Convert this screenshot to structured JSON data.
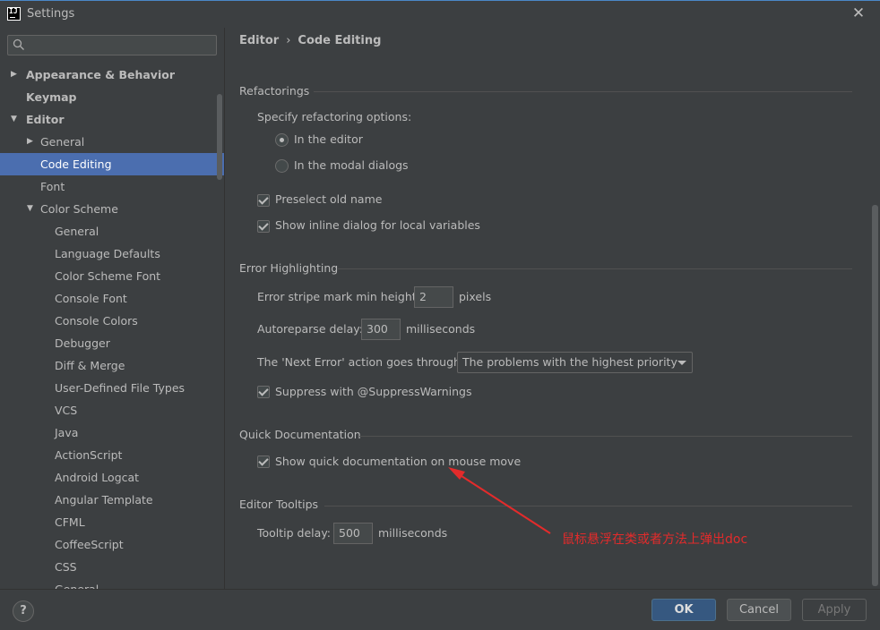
{
  "window": {
    "title": "Settings",
    "app_icon_text": "IJ"
  },
  "search": {
    "placeholder": ""
  },
  "tree": [
    {
      "label": "Appearance & Behavior",
      "level": 0,
      "arrow": "right",
      "bold": true,
      "selected": false
    },
    {
      "label": "Keymap",
      "level": 0,
      "arrow": "",
      "bold": true,
      "selected": false
    },
    {
      "label": "Editor",
      "level": 0,
      "arrow": "down",
      "bold": true,
      "selected": false
    },
    {
      "label": "General",
      "level": 1,
      "arrow": "right",
      "bold": false,
      "selected": false
    },
    {
      "label": "Code Editing",
      "level": 1,
      "arrow": "",
      "bold": false,
      "selected": true
    },
    {
      "label": "Font",
      "level": 1,
      "arrow": "",
      "bold": false,
      "selected": false
    },
    {
      "label": "Color Scheme",
      "level": 1,
      "arrow": "down",
      "bold": false,
      "selected": false
    },
    {
      "label": "General",
      "level": 2,
      "arrow": "",
      "bold": false,
      "selected": false
    },
    {
      "label": "Language Defaults",
      "level": 2,
      "arrow": "",
      "bold": false,
      "selected": false
    },
    {
      "label": "Color Scheme Font",
      "level": 2,
      "arrow": "",
      "bold": false,
      "selected": false
    },
    {
      "label": "Console Font",
      "level": 2,
      "arrow": "",
      "bold": false,
      "selected": false
    },
    {
      "label": "Console Colors",
      "level": 2,
      "arrow": "",
      "bold": false,
      "selected": false
    },
    {
      "label": "Debugger",
      "level": 2,
      "arrow": "",
      "bold": false,
      "selected": false
    },
    {
      "label": "Diff & Merge",
      "level": 2,
      "arrow": "",
      "bold": false,
      "selected": false
    },
    {
      "label": "User-Defined File Types",
      "level": 2,
      "arrow": "",
      "bold": false,
      "selected": false
    },
    {
      "label": "VCS",
      "level": 2,
      "arrow": "",
      "bold": false,
      "selected": false
    },
    {
      "label": "Java",
      "level": 2,
      "arrow": "",
      "bold": false,
      "selected": false
    },
    {
      "label": "ActionScript",
      "level": 2,
      "arrow": "",
      "bold": false,
      "selected": false
    },
    {
      "label": "Android Logcat",
      "level": 2,
      "arrow": "",
      "bold": false,
      "selected": false
    },
    {
      "label": "Angular Template",
      "level": 2,
      "arrow": "",
      "bold": false,
      "selected": false
    },
    {
      "label": "CFML",
      "level": 2,
      "arrow": "",
      "bold": false,
      "selected": false
    },
    {
      "label": "CoffeeScript",
      "level": 2,
      "arrow": "",
      "bold": false,
      "selected": false
    },
    {
      "label": "CSS",
      "level": 2,
      "arrow": "",
      "bold": false,
      "selected": false
    },
    {
      "label": "General",
      "level": 2,
      "arrow": "",
      "bold": false,
      "selected": false
    }
  ],
  "breadcrumb": {
    "part1": "Editor",
    "separator": "›",
    "part2": "Code Editing"
  },
  "refactorings": {
    "title": "Refactorings",
    "specify_label": "Specify refactoring options:",
    "radio_editor": "In the editor",
    "radio_editor_selected": true,
    "radio_modal": "In the modal dialogs",
    "radio_modal_selected": false,
    "preselect_label": "Preselect old name",
    "preselect_checked": true,
    "inline_dialog_label": "Show inline dialog for local variables",
    "inline_dialog_checked": true
  },
  "error_highlighting": {
    "title": "Error Highlighting",
    "stripe_label": "Error stripe mark min height:",
    "stripe_value": "2",
    "stripe_unit": "pixels",
    "autoreparse_label": "Autoreparse delay:",
    "autoreparse_value": "300",
    "autoreparse_unit": "milliseconds",
    "next_error_label": "The 'Next Error' action goes through:",
    "next_error_value": "The problems with the highest priority",
    "suppress_label": "Suppress with @SuppressWarnings",
    "suppress_checked": true
  },
  "quick_documentation": {
    "title": "Quick Documentation",
    "show_doc_label": "Show quick documentation on mouse move",
    "show_doc_checked": true
  },
  "editor_tooltips": {
    "title": "Editor Tooltips",
    "delay_label": "Tooltip delay:",
    "delay_value": "500",
    "delay_unit": "milliseconds"
  },
  "annotation": {
    "text": "鼠标悬浮在类或者方法上弹出doc",
    "color": "#e32b2b"
  },
  "footer": {
    "help_label": "?",
    "ok_label": "OK",
    "cancel_label": "Cancel",
    "apply_label": "Apply"
  },
  "colors": {
    "background": "#3c3f41",
    "selection": "#4b6eaf",
    "ok_button": "#365880"
  }
}
